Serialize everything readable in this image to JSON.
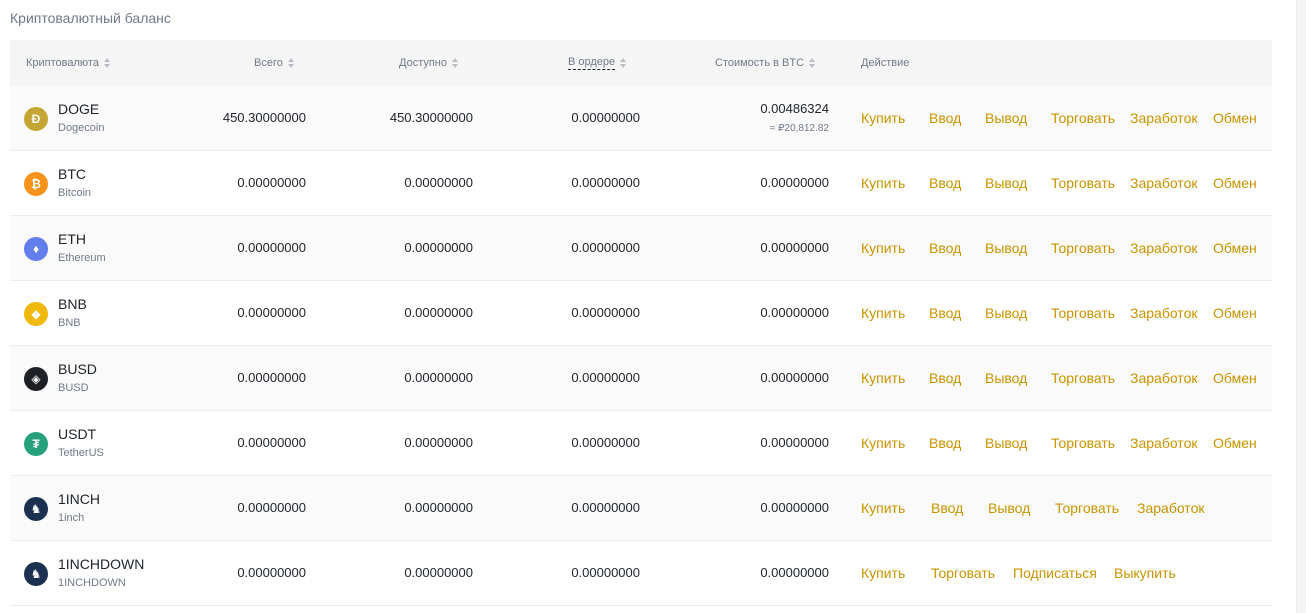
{
  "page": {
    "title": "Криптовалютный баланс"
  },
  "columns": {
    "crypto": "Криптовалюта",
    "total": "Всего",
    "available": "Доступно",
    "in_order": "В ордере",
    "btc_value": "Стоимость в BTC",
    "action": "Действие"
  },
  "colors": {
    "accent": "#c99400",
    "header_bg": "#f5f5f5",
    "muted_text": "#707a8a"
  },
  "rows": [
    {
      "symbol": "DOGE",
      "name": "Dogecoin",
      "icon": "doge-icon",
      "icon_color": "#c3a634",
      "total": "450.30000000",
      "available": "450.30000000",
      "in_order": "0.00000000",
      "btc": "0.00486324",
      "fiat": "≈ ₽20,812.82",
      "actions": [
        "Купить",
        "Ввод",
        "Вывод",
        "Торговать",
        "Заработок",
        "Обмен"
      ]
    },
    {
      "symbol": "BTC",
      "name": "Bitcoin",
      "icon": "bitcoin-icon",
      "icon_color": "#f7931a",
      "total": "0.00000000",
      "available": "0.00000000",
      "in_order": "0.00000000",
      "btc": "0.00000000",
      "actions": [
        "Купить",
        "Ввод",
        "Вывод",
        "Торговать",
        "Заработок",
        "Обмен"
      ]
    },
    {
      "symbol": "ETH",
      "name": "Ethereum",
      "icon": "ethereum-icon",
      "icon_color": "#627eea",
      "total": "0.00000000",
      "available": "0.00000000",
      "in_order": "0.00000000",
      "btc": "0.00000000",
      "actions": [
        "Купить",
        "Ввод",
        "Вывод",
        "Торговать",
        "Заработок",
        "Обмен"
      ]
    },
    {
      "symbol": "BNB",
      "name": "BNB",
      "icon": "bnb-icon",
      "icon_color": "#f0b90b",
      "total": "0.00000000",
      "available": "0.00000000",
      "in_order": "0.00000000",
      "btc": "0.00000000",
      "actions": [
        "Купить",
        "Ввод",
        "Вывод",
        "Торговать",
        "Заработок",
        "Обмен"
      ]
    },
    {
      "symbol": "BUSD",
      "name": "BUSD",
      "icon": "busd-icon",
      "icon_color": "#1e2026",
      "total": "0.00000000",
      "available": "0.00000000",
      "in_order": "0.00000000",
      "btc": "0.00000000",
      "actions": [
        "Купить",
        "Ввод",
        "Вывод",
        "Торговать",
        "Заработок",
        "Обмен"
      ]
    },
    {
      "symbol": "USDT",
      "name": "TetherUS",
      "icon": "tether-icon",
      "icon_color": "#26a17b",
      "total": "0.00000000",
      "available": "0.00000000",
      "in_order": "0.00000000",
      "btc": "0.00000000",
      "actions": [
        "Купить",
        "Ввод",
        "Вывод",
        "Торговать",
        "Заработок",
        "Обмен"
      ]
    },
    {
      "symbol": "1INCH",
      "name": "1inch",
      "icon": "1inch-icon",
      "icon_color": "#1b314f",
      "total": "0.00000000",
      "available": "0.00000000",
      "in_order": "0.00000000",
      "btc": "0.00000000",
      "actions": [
        "Купить",
        "Ввод",
        "Вывод",
        "Торговать",
        "Заработок"
      ]
    },
    {
      "symbol": "1INCHDOWN",
      "name": "1INCHDOWN",
      "icon": "1inch-icon",
      "icon_color": "#1b314f",
      "total": "0.00000000",
      "available": "0.00000000",
      "in_order": "0.00000000",
      "btc": "0.00000000",
      "actions": [
        "Купить",
        "Торговать",
        "Подписаться",
        "Выкупить"
      ]
    }
  ]
}
